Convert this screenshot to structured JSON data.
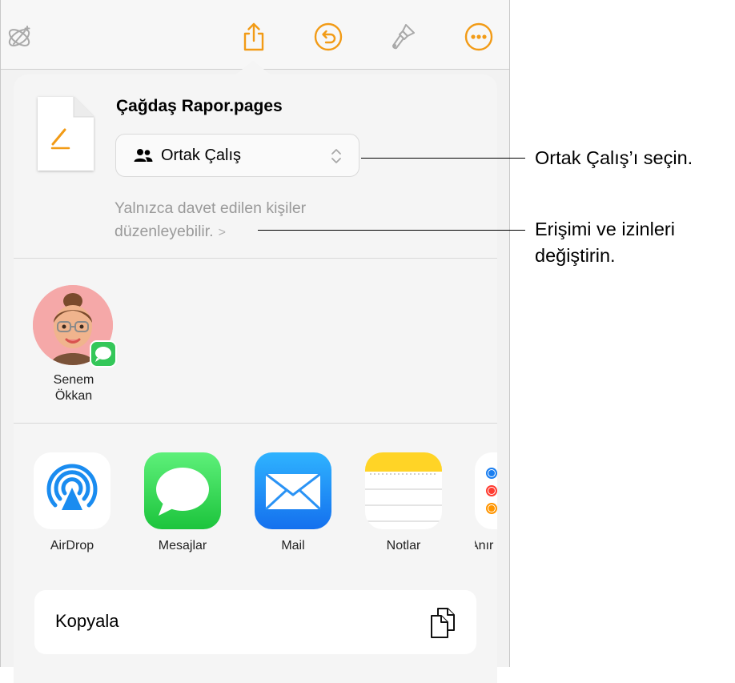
{
  "colors": {
    "accent": "#f29b16",
    "sheet_background": "#f5f5f5",
    "secondary_text": "#9a9a9a",
    "messages_green": "#34c759",
    "mail_blue": "#1f8ef2",
    "airdrop_blue": "#1a8cf0",
    "avatar_pink": "#f5a8a8"
  },
  "toolbar": {
    "icons": [
      "magic-wand-icon",
      "share-icon",
      "undo-icon",
      "paintbrush-icon",
      "more-icon"
    ]
  },
  "document": {
    "title": "Çağdaş Rapor.pages",
    "icon": "pages-document-icon"
  },
  "collaboration": {
    "selected": "Ortak Çalış",
    "icon": "people-icon",
    "access_line1": "Yalnızca davet edilen kişiler",
    "access_line2": "düzenleyebilir.",
    "access_chevron": ">"
  },
  "contacts": [
    {
      "first": "Senem",
      "last": "Ökkan",
      "badge": "messages-icon"
    }
  ],
  "apps": [
    {
      "label": "AirDrop",
      "icon": "airdrop-icon"
    },
    {
      "label": "Mesajlar",
      "icon": "messages-icon"
    },
    {
      "label": "Mail",
      "icon": "mail-icon"
    },
    {
      "label": "Notlar",
      "icon": "notes-icon"
    },
    {
      "label": "Anır",
      "icon": "reminders-icon"
    }
  ],
  "actions": {
    "copy_label": "Kopyala",
    "copy_icon": "copy-icon"
  },
  "callouts": {
    "first": "Ortak Çalış’ı seçin.",
    "second_line1": "Erişimi ve izinleri",
    "second_line2": "değiştirin."
  }
}
